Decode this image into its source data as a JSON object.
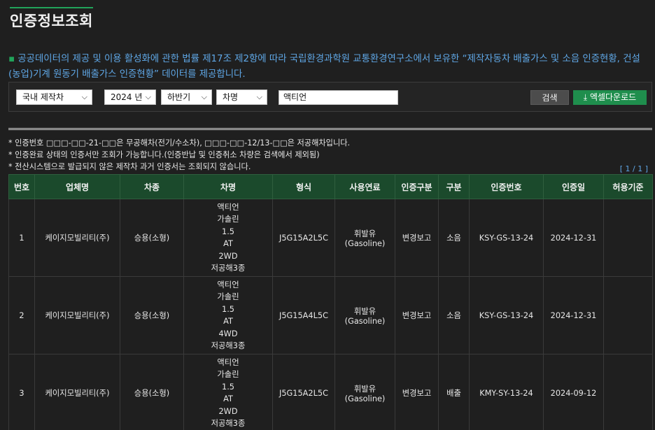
{
  "page": {
    "title": "인증정보조회"
  },
  "intro": {
    "bullet": "▪",
    "text": "공공데이터의 제공 및 이용 활성화에 관한 법률 제17조 제2항에 따라 국립환경과학원 교통환경연구소에서 보유한 “제작자동차 배출가스 및 소음 인증현황, 건설(농업)기계 원동기 배출가스 인증현황” 데이터를 제공합니다."
  },
  "search": {
    "category": "국내 제작차",
    "year": "2024 년",
    "half": "하반기",
    "field": "차명",
    "query": "액티언",
    "search_label": "검색",
    "excel_label": "엑셀다운로드"
  },
  "notes": [
    "* 인증번호 □□□-□□-21-□□은 무공해차(전기/수소차), □□□-□□-12/13-□□은 저공해차입니다.",
    "* 인증완료 상태의 인증서만 조회가 가능합니다.(인증반납 및 인증취소 차량은 검색에서 제외됨)",
    "* 전산시스템으로 발급되지 않은 제작차 과거 인증서는 조회되지 않습니다."
  ],
  "pager": "[ 1 / 1 ]",
  "table": {
    "headers": [
      "번호",
      "업체명",
      "차종",
      "차명",
      "형식",
      "사용연료",
      "인증구분",
      "구분",
      "인증번호",
      "인증일",
      "허용기준"
    ],
    "rows": [
      {
        "no": "1",
        "company": "케이지모빌리티(주)",
        "type": "승용(소형)",
        "name": [
          "액티언",
          "가솔린",
          "1.5",
          "AT",
          "2WD",
          "저공해3종"
        ],
        "model": "J5G15A2L5C",
        "fuel": "휘발유(Gasoline)",
        "cert_type": "변경보고",
        "category": "소음",
        "cert_no": "KSY-GS-13-24",
        "date": "2024-12-31",
        "standard": ""
      },
      {
        "no": "2",
        "company": "케이지모빌리티(주)",
        "type": "승용(소형)",
        "name": [
          "액티언",
          "가솔린",
          "1.5",
          "AT",
          "4WD",
          "저공해3종"
        ],
        "model": "J5G15A4L5C",
        "fuel": "휘발유(Gasoline)",
        "cert_type": "변경보고",
        "category": "소음",
        "cert_no": "KSY-GS-13-24",
        "date": "2024-12-31",
        "standard": ""
      },
      {
        "no": "3",
        "company": "케이지모빌리티(주)",
        "type": "승용(소형)",
        "name": [
          "액티언",
          "가솔린",
          "1.5",
          "AT",
          "2WD",
          "저공해3종"
        ],
        "model": "J5G15A2L5C",
        "fuel": "휘발유(Gasoline)",
        "cert_type": "변경보고",
        "category": "배출",
        "cert_no": "KMY-SY-13-24",
        "date": "2024-09-12",
        "standard": ""
      }
    ]
  },
  "icons": {
    "dropdown": "chevron-down-icon",
    "download": "download-icon"
  },
  "colors": {
    "accent": "#21a35a",
    "link": "#5fa7e6",
    "header_bg": "#1b4a2c",
    "excel_btn": "#1f8e4d"
  }
}
